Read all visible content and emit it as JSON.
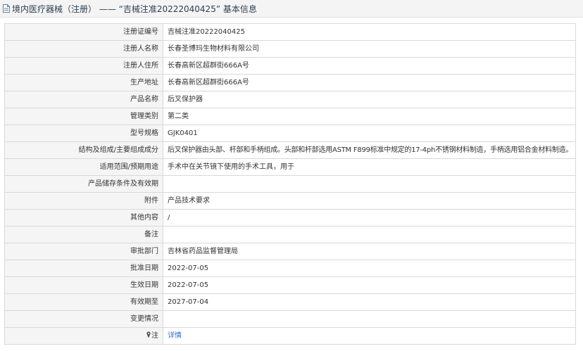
{
  "header": {
    "title": "境内医疗器械（注册） —— “吉械注准20222040425” 基本信息",
    "icon": "document-icon"
  },
  "rows": [
    {
      "label": "注册证编号",
      "value": "吉械注准20222040425"
    },
    {
      "label": "注册人名称",
      "value": "长春圣博玛生物材料有限公司"
    },
    {
      "label": "注册人住所",
      "value": "长春高新区超群街666A号"
    },
    {
      "label": "生产地址",
      "value": "长春高新区超群街666A号"
    },
    {
      "label": "产品名称",
      "value": "后叉保护器"
    },
    {
      "label": "管理类别",
      "value": "第二类"
    },
    {
      "label": "型号规格",
      "value": "GJK0401"
    },
    {
      "label": "结构及组成/主要组成成分",
      "value": "后叉保护器由头部、杆部和手柄组成。头部和杆部选用ASTM F899标准中规定的17-4ph不锈钢材料制造，手柄选用铝合金材料制造。"
    },
    {
      "label": "适用范围/预期用途",
      "value": "手术中在关节镜下使用的手术工具，用于"
    },
    {
      "label": "产品储存条件及有效期",
      "value": ""
    },
    {
      "label": "附件",
      "value": "产品技术要求"
    },
    {
      "label": "其他内容",
      "value": "/"
    },
    {
      "label": "备注",
      "value": ""
    },
    {
      "label": "审批部门",
      "value": "吉林省药品监督管理局"
    },
    {
      "label": "批准日期",
      "value": "2022-07-05"
    },
    {
      "label": "生效日期",
      "value": "2022-07-05"
    },
    {
      "label": "有效期至",
      "value": "2027-07-04"
    },
    {
      "label": "变更情况",
      "value": ""
    }
  ],
  "note_row": {
    "label": "注",
    "link_text": "详情",
    "icon": "map-pin-icon"
  },
  "colors": {
    "label_bg": "#f5f5f5",
    "border": "#d9d9d9",
    "link": "#2f6fd1",
    "header_bg": "#f4f4f4"
  }
}
